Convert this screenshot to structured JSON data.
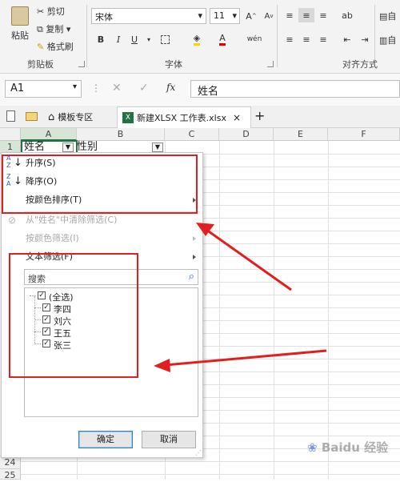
{
  "ribbon": {
    "clipboard": {
      "paste": "粘贴",
      "cut": "剪切",
      "copy": "复制",
      "format_painter": "格式刷",
      "group": "剪贴板"
    },
    "font": {
      "name": "宋体",
      "size": "11",
      "bold": "B",
      "italic": "I",
      "underline": "U",
      "group": "字体",
      "grow": "A",
      "shrink": "A"
    },
    "align": {
      "group": "对齐方式",
      "wrap": "自",
      "merge": "自"
    }
  },
  "formula_bar": {
    "name_box": "A1",
    "fx": "fx",
    "value": "姓名"
  },
  "tabs": {
    "template": "模板专区",
    "file": "新建XLSX 工作表.xlsx",
    "close": "×",
    "add": "+"
  },
  "grid": {
    "columns": [
      "A",
      "B",
      "C",
      "D",
      "E",
      "F"
    ],
    "rows": [
      "1",
      "24",
      "25"
    ],
    "a1": "姓名",
    "b1": "性别"
  },
  "menu": {
    "sort_asc": "升序(S)",
    "sort_desc": "降序(O)",
    "sort_color": "按颜色排序(T)",
    "clear_filter": "从\"姓名\"中清除筛选(C)",
    "filter_color": "按颜色筛选(I)",
    "text_filter": "文本筛选(F)",
    "search_placeholder": "搜索",
    "items": [
      "(全选)",
      "李四",
      "刘六",
      "王五",
      "张三"
    ],
    "ok": "确定",
    "cancel": "取消"
  },
  "watermark": "Baidu 经验",
  "colors": {
    "annotation_red": "#e02020",
    "accent_green": "#217346"
  }
}
